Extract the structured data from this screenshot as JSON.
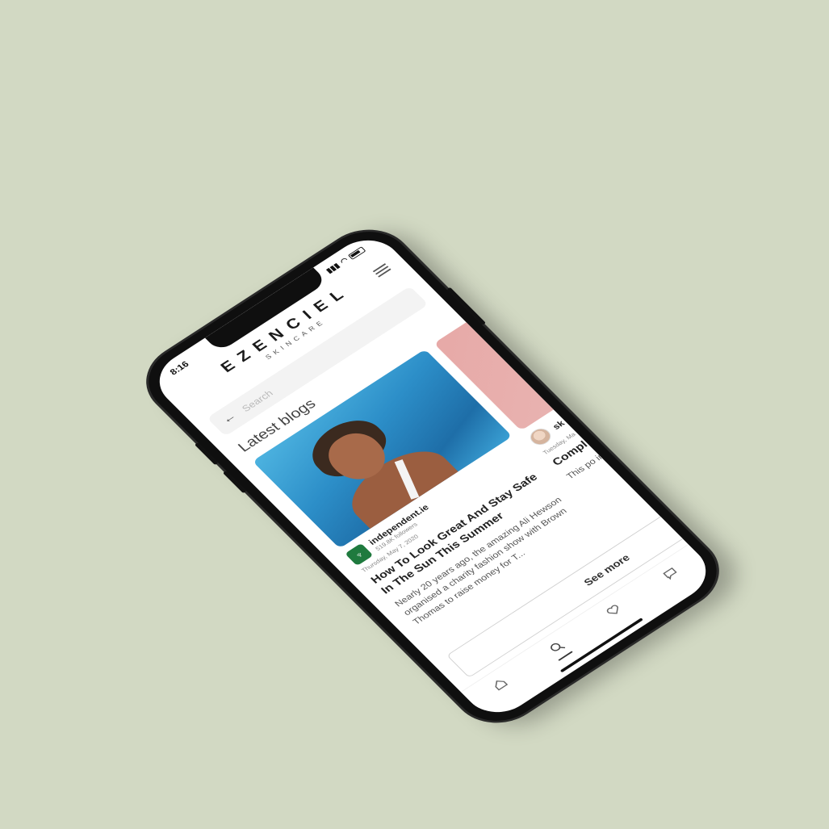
{
  "status_bar": {
    "time": "8:16"
  },
  "brand": {
    "name": "EZENCIEL",
    "tagline": "SKINCARE"
  },
  "search": {
    "placeholder": "Search"
  },
  "blogs": {
    "section_title": "Latest blogs",
    "posts": [
      {
        "source": "independent.ie",
        "followers": "519.8K followers",
        "date": "Thursday, May 7, 2020",
        "title": "How To Look Great And Stay Safe In The Sun This Summer",
        "excerpt": "Nearly 20 years ago, the amazing Ali Hewson organised a charity fashion show with Brown Thomas to raise money for T..."
      },
      {
        "source": "sk",
        "date": "Tuesday, Ma",
        "title": "Compl Ingred",
        "excerpt": "This po ingredi non-co"
      }
    ],
    "see_more_label": "See more"
  },
  "tab_bar": {
    "items": [
      {
        "name": "home",
        "icon": "home-icon"
      },
      {
        "name": "search",
        "icon": "search-icon",
        "active": true
      },
      {
        "name": "favorites",
        "icon": "heart-icon"
      },
      {
        "name": "chat",
        "icon": "chat-icon"
      }
    ]
  },
  "colors": {
    "background": "#d2d9c3",
    "phone_frame": "#0f0f0f",
    "source_badge": "#1f7a3e"
  }
}
